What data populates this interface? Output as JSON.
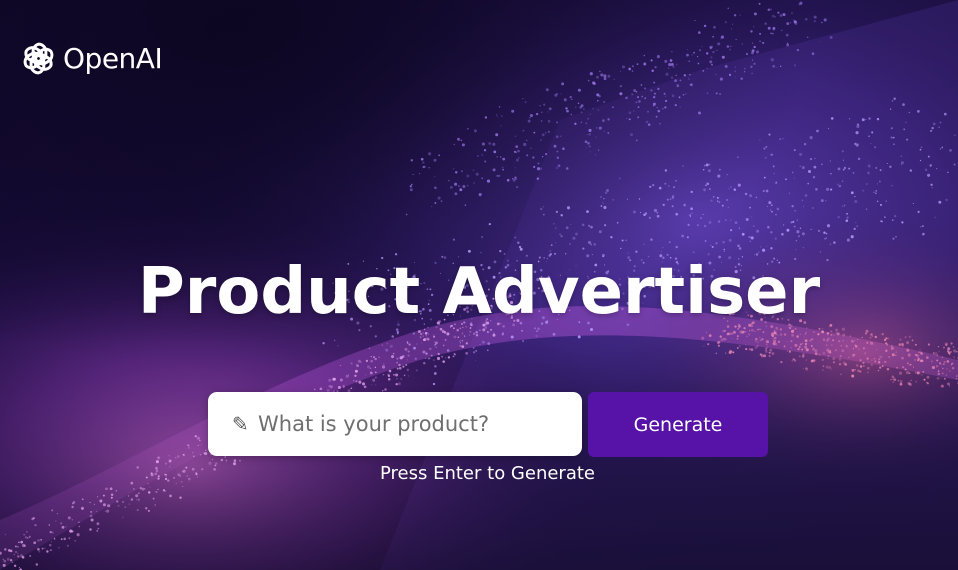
{
  "brand": {
    "name": "OpenAI",
    "logo_icon": "openai-logo-icon"
  },
  "hero": {
    "title": "Product Advertiser"
  },
  "search": {
    "icon": "pencil-icon",
    "placeholder": "What is your product?",
    "value": ""
  },
  "actions": {
    "generate_label": "Generate"
  },
  "hint": {
    "text": "Press Enter to Generate"
  },
  "colors": {
    "background_dark": "#120826",
    "accent_purple": "#5712a8",
    "particle_pink": "#d46bd6",
    "particle_violet": "#8a5cff",
    "text": "#ffffff"
  }
}
